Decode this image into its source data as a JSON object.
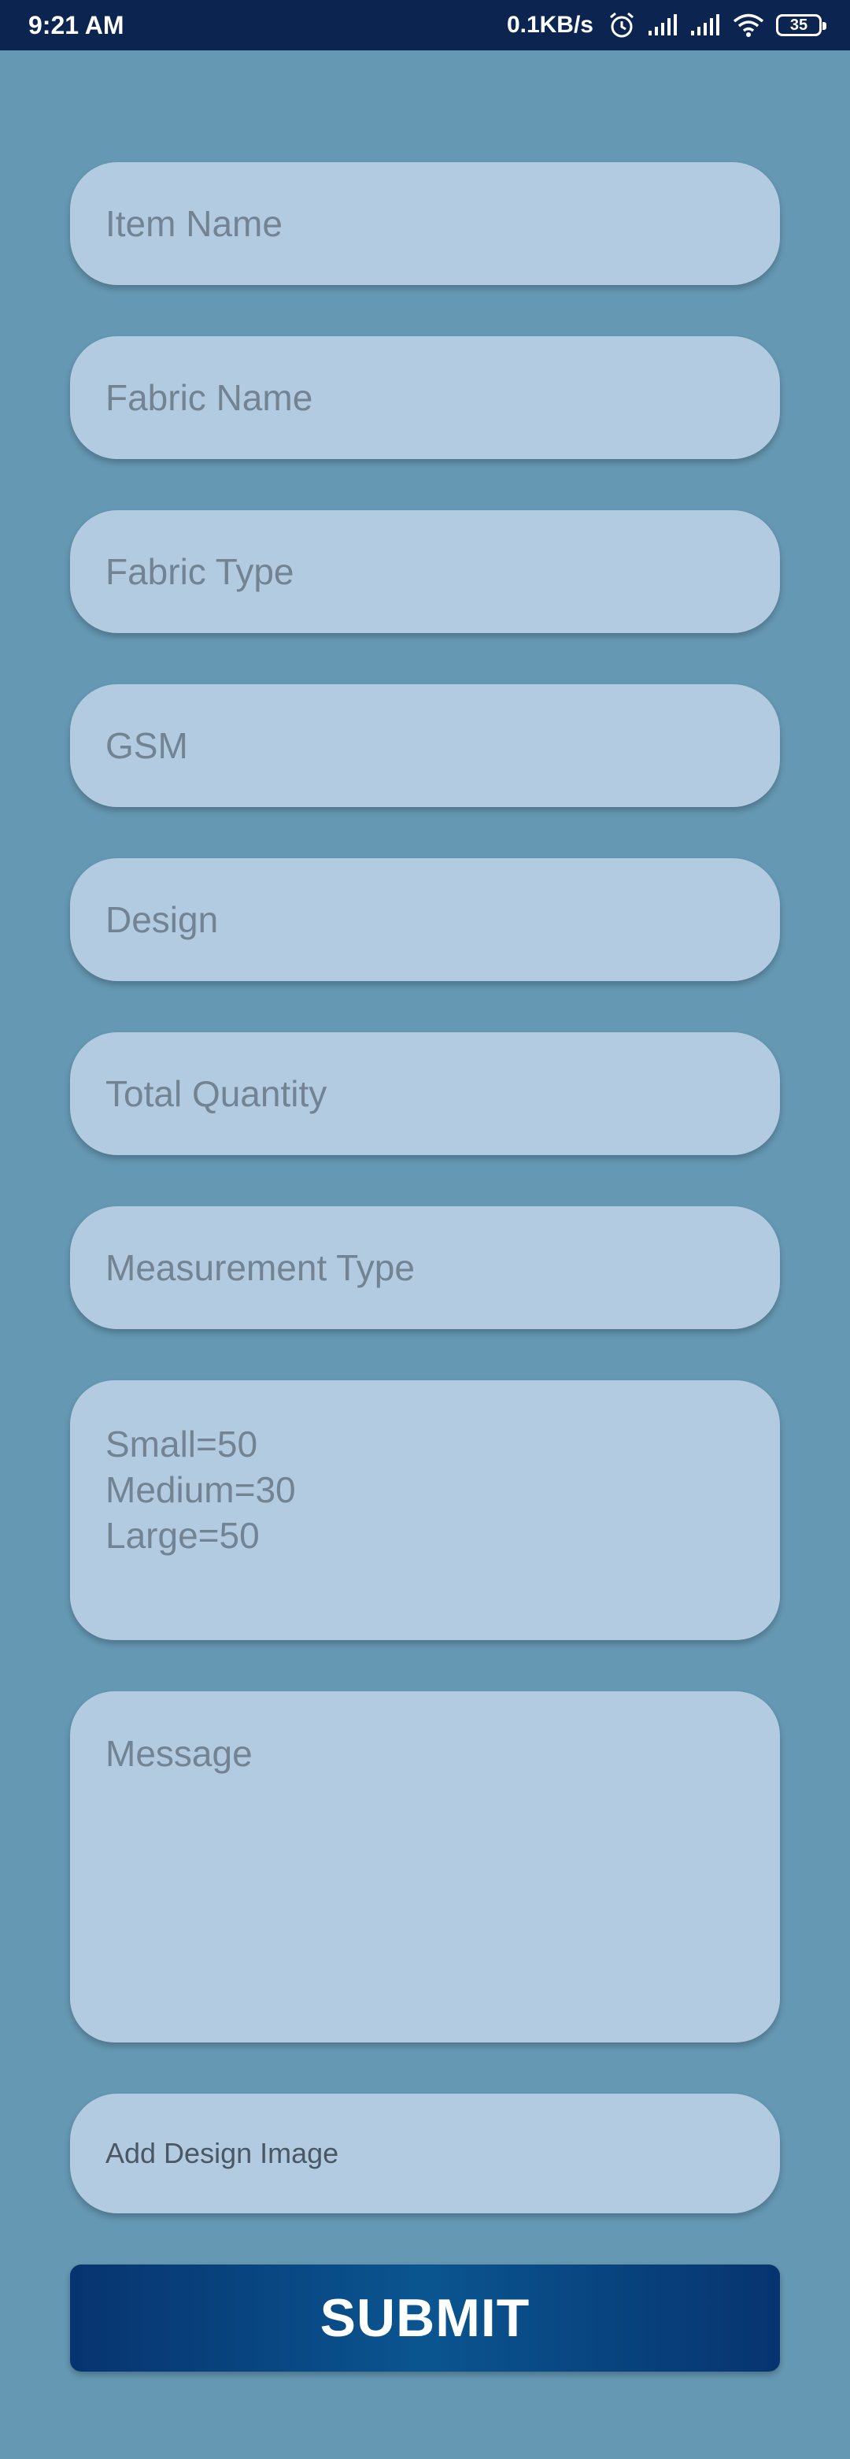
{
  "status_bar": {
    "time": "9:21 AM",
    "network_speed": "0.1KB/s",
    "battery_level": "35",
    "icons": [
      "alarm-icon",
      "signal-icon",
      "signal-icon",
      "wifi-icon",
      "battery-icon"
    ]
  },
  "form": {
    "item_name_placeholder": "Item Name",
    "fabric_name_placeholder": "Fabric Name",
    "fabric_type_placeholder": "Fabric Type",
    "gsm_placeholder": "GSM",
    "design_placeholder": "Design",
    "total_quantity_placeholder": "Total Quantity",
    "measurement_type_placeholder": "Measurement Type",
    "size_breakdown_value": "Small=50\nMedium=30\nLarge=50",
    "message_placeholder": "Message",
    "add_design_image_label": "Add Design Image",
    "submit_label": "SUBMIT"
  },
  "colors": {
    "background": "#6598b3",
    "field": "#b2cbe0",
    "status_bar": "#0b2550",
    "submit": "#0a5590"
  }
}
